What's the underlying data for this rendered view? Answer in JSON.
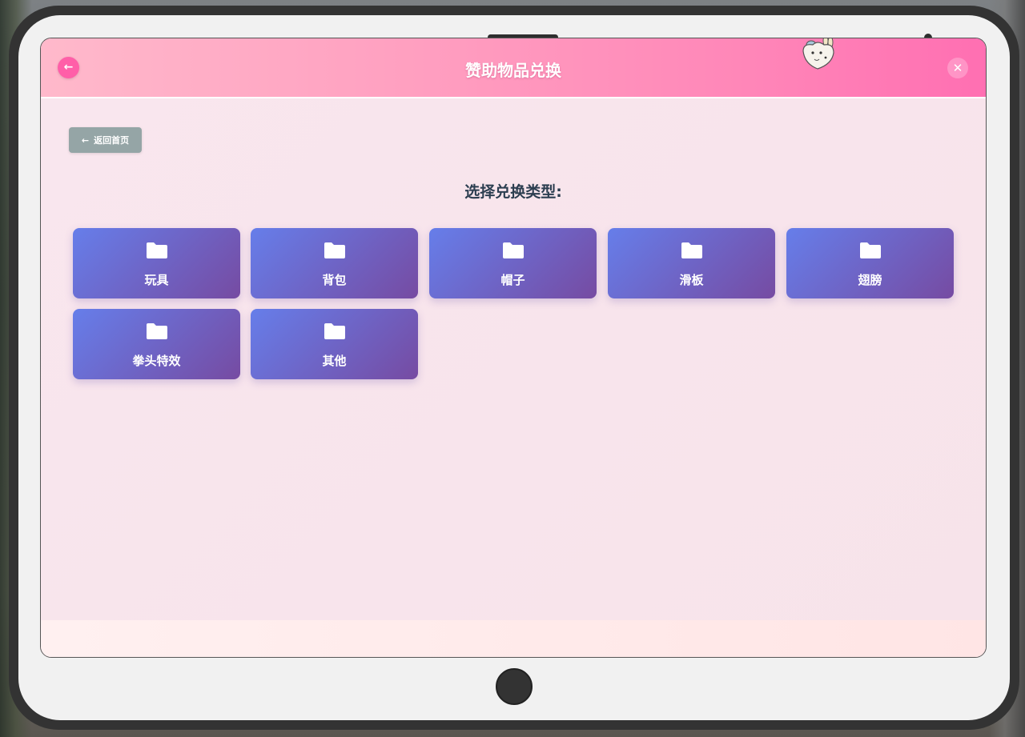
{
  "header": {
    "title": "赞助物品兑换",
    "back_icon": "←",
    "close_icon": "✕"
  },
  "home_button": {
    "icon": "←",
    "label": "返回首页"
  },
  "section": {
    "title": "选择兑换类型:"
  },
  "categories": [
    {
      "label": "玩具",
      "icon": "folder-icon"
    },
    {
      "label": "背包",
      "icon": "folder-icon"
    },
    {
      "label": "帽子",
      "icon": "folder-icon"
    },
    {
      "label": "滑板",
      "icon": "folder-icon"
    },
    {
      "label": "翅膀",
      "icon": "folder-icon"
    },
    {
      "label": "拳头特效",
      "icon": "folder-icon"
    },
    {
      "label": "其他",
      "icon": "folder-icon"
    }
  ],
  "colors": {
    "header_gradient": [
      "#ffb9cb",
      "#ff6fb2"
    ],
    "card_gradient": [
      "#667eea",
      "#764ba2"
    ],
    "home_button": "#95a5a6",
    "title_text": "#2c3e50"
  }
}
